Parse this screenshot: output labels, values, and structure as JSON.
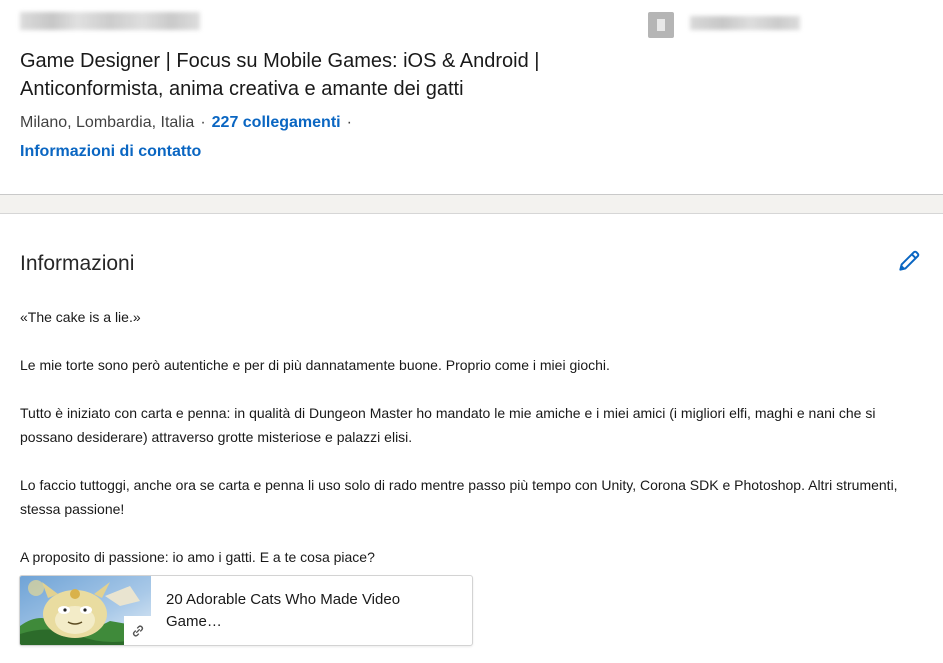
{
  "profile": {
    "headline": "Game Designer | Focus su Mobile Games: iOS & Android | Anticonformista, anima creativa e amante dei gatti",
    "location": "Milano, Lombardia, Italia",
    "separator": "·",
    "connections": "227 collegamenti",
    "contact_link": "Informazioni di contatto"
  },
  "about": {
    "title": "Informazioni",
    "paragraphs": [
      "«The cake is a lie.»",
      "Le mie torte sono però autentiche e per di più dannatamente buone. Proprio come i miei giochi.",
      "Tutto è iniziato con carta e penna: in qualità di Dungeon Master ho mandato le mie amiche e i miei amici (i migliori elfi, maghi e nani che si possano desiderare) attraverso grotte misteriose e palazzi elisi.",
      "Lo faccio tuttoggi, anche ora se carta e penna li uso solo di rado mentre passo più tempo con Unity, Corona SDK e Photoshop. Altri strumenti, stessa passione!",
      "A proposito di passione: io amo i gatti. E a te cosa piace?"
    ],
    "media": {
      "title": "20 Adorable Cats Who Made Video Game…"
    }
  },
  "icons": {
    "edit": "pencil-icon",
    "company": "building-icon",
    "media_link": "link-icon"
  },
  "colors": {
    "link": "#0a66c2",
    "background": "#f3f2ef"
  }
}
